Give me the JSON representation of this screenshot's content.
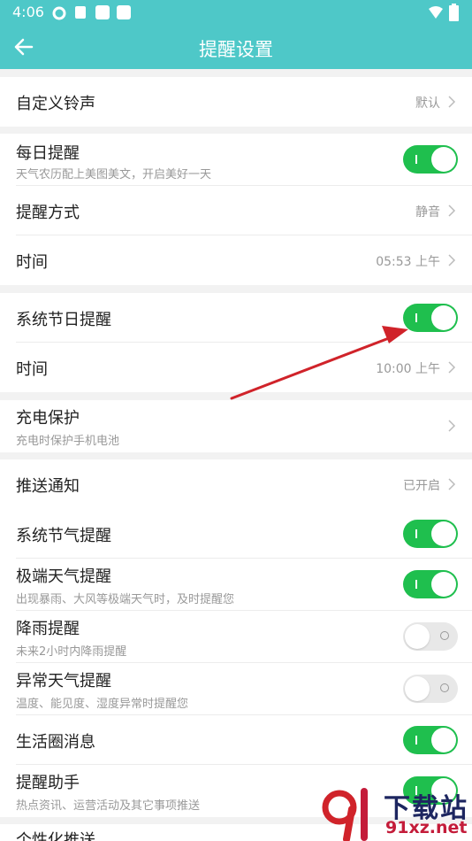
{
  "status_bar": {
    "time": "4:06"
  },
  "app_bar": {
    "title": "提醒设置"
  },
  "rows": {
    "ringtone": {
      "label": "自定义铃声",
      "value": "默认"
    },
    "daily": {
      "label": "每日提醒",
      "desc": "天气农历配上美图美文，开启美好一天",
      "toggle": "on"
    },
    "method": {
      "label": "提醒方式",
      "value": "静音"
    },
    "daily_time": {
      "label": "时间",
      "value": "05:53 上午"
    },
    "holiday": {
      "label": "系统节日提醒",
      "toggle": "on"
    },
    "holiday_time": {
      "label": "时间",
      "value": "10:00 上午"
    },
    "charge": {
      "label": "充电保护",
      "desc": "充电时保护手机电池"
    },
    "push": {
      "label": "推送通知",
      "value": "已开启"
    },
    "solar_term": {
      "label": "系统节气提醒",
      "toggle": "on"
    },
    "extreme": {
      "label": "极端天气提醒",
      "desc": "出现暴雨、大风等极端天气时，及时提醒您",
      "toggle": "on"
    },
    "rain": {
      "label": "降雨提醒",
      "desc": "未来2小时内降雨提醒",
      "toggle": "off"
    },
    "abnormal": {
      "label": "异常天气提醒",
      "desc": "温度、能见度、湿度异常时提醒您",
      "toggle": "off"
    },
    "life": {
      "label": "生活圈消息",
      "toggle": "on"
    },
    "assistant": {
      "label": "提醒助手",
      "desc": "热点资讯、运营活动及其它事项推送",
      "toggle": "on"
    },
    "personal": {
      "label": "个性化推送"
    }
  },
  "watermark": {
    "brand": "下载站",
    "domain": "91xz.net"
  },
  "colors": {
    "header": "#4ec8c8",
    "toggle_on": "#1fbf4e",
    "annotation_arrow": "#d0232a"
  }
}
